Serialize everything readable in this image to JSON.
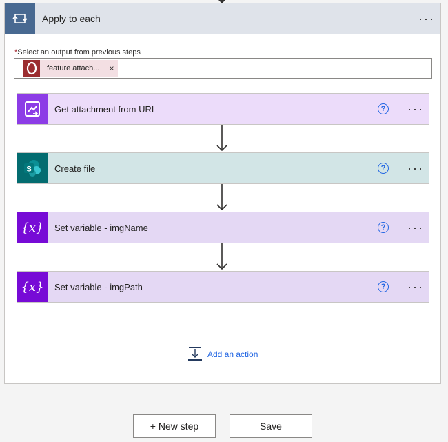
{
  "loop": {
    "title": "Apply to each",
    "more_label": "···",
    "field_label": "Select an output from previous steps",
    "required_mark": "*",
    "token": {
      "label": "feature attach...",
      "close": "×",
      "color": "#9b2d30"
    }
  },
  "actions": [
    {
      "title": "Get attachment from URL",
      "icon": "url-attachment-icon",
      "color": "#8c3ce6",
      "help": "?",
      "more": "···"
    },
    {
      "title": "Create file",
      "icon": "sharepoint-icon",
      "color": "#036c70",
      "help": "?",
      "more": "···"
    },
    {
      "title": "Set variable - imgName",
      "icon": "variable-icon",
      "color": "#770bd6",
      "help": "?",
      "more": "···"
    },
    {
      "title": "Set variable - imgPath",
      "icon": "variable-icon",
      "color": "#770bd6",
      "help": "?",
      "more": "···"
    }
  ],
  "add_action_label": "Add an action",
  "buttons": {
    "new_step": "+ New step",
    "save": "Save"
  },
  "variable_glyph": "{x}",
  "sharepoint_letter": "S"
}
